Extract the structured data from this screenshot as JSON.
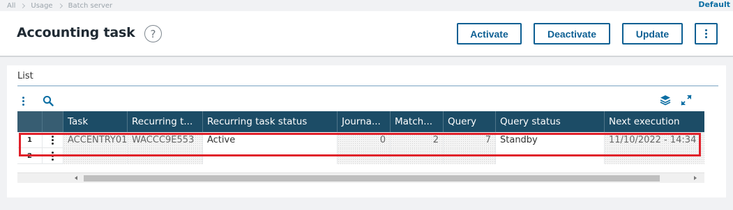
{
  "breadcrumb": {
    "items": [
      "All",
      "Usage",
      "Batch server"
    ]
  },
  "top_right_link": "Default",
  "header": {
    "title": "Accounting task",
    "help_icon": "question-circle-icon",
    "actions": {
      "activate": "Activate",
      "deactivate": "Deactivate",
      "update": "Update",
      "more_icon": "vertical-dots-icon"
    }
  },
  "list": {
    "title": "List",
    "toolbar": {
      "left": [
        "vertical-dots-icon",
        "search-icon"
      ],
      "right": [
        "layers-icon",
        "expand-icon"
      ]
    },
    "columns": [
      "Task",
      "Recurring t...",
      "Recurring task status",
      "Journa...",
      "Match...",
      "Query",
      "Query status",
      "Next execution"
    ],
    "rows": [
      {
        "num": "1",
        "task": "ACCENTRY01",
        "recurring_task": "WACCC9E553",
        "recurring_task_status": "Active",
        "journal": "0",
        "match": "2",
        "query": "7",
        "query_status": "Standby",
        "next_execution": "11/10/2022 - 14:34"
      },
      {
        "num": "2",
        "task": "",
        "recurring_task": "",
        "recurring_task_status": "",
        "journal": "",
        "match": "",
        "query": "",
        "query_status": "",
        "next_execution": ""
      }
    ]
  },
  "colors": {
    "accent": "#0d5f93",
    "grid_header": "#1c4c66",
    "highlight": "#e0202a"
  }
}
